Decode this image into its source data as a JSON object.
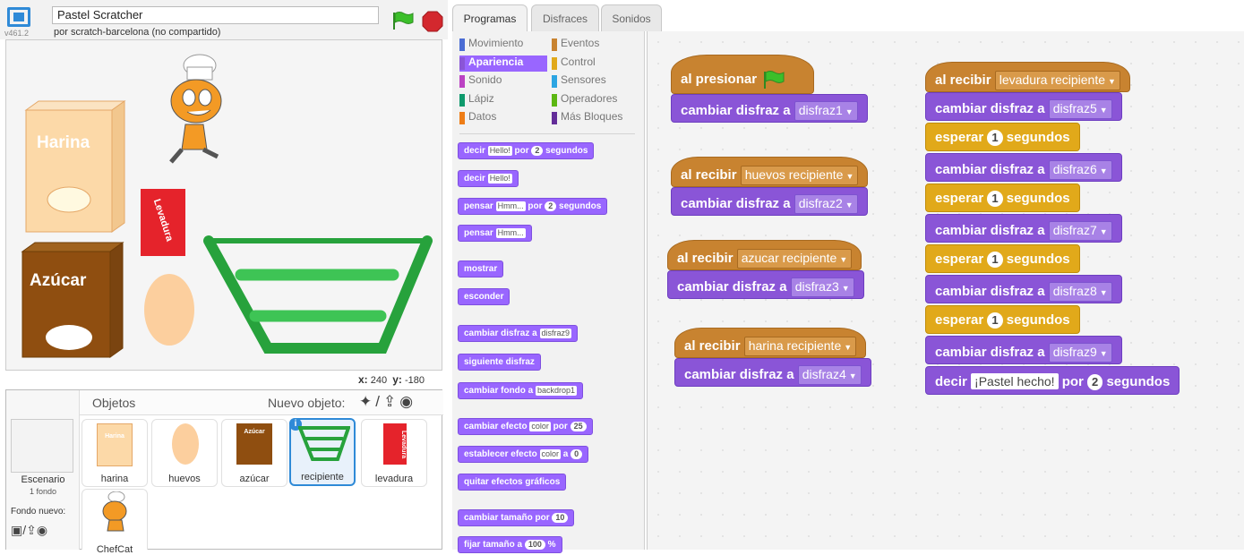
{
  "header": {
    "title": "Pastel Scratcher",
    "byline": "por scratch-barcelona (no compartido)",
    "version": "v461.2"
  },
  "stage": {
    "x_label": "x:",
    "x": "240",
    "y_label": "y:",
    "y": "-180",
    "items": {
      "harina": "Harina",
      "azucar": "Azúcar",
      "levadura": "Levadura"
    }
  },
  "sprites": {
    "title": "Objetos",
    "new_sprite": "Nuevo objeto:",
    "stage_label": "Escenario",
    "stage_sub": "1 fondo",
    "new_backdrop": "Fondo nuevo:",
    "tiles": [
      "harina",
      "huevos",
      "azúcar",
      "recipiente",
      "levadura",
      "ChefCat"
    ],
    "tile_texts": {
      "harina": "Harina",
      "azucar": "Azúcar",
      "levadura": "Levadura"
    }
  },
  "tabs": [
    "Programas",
    "Disfraces",
    "Sonidos"
  ],
  "categories": [
    {
      "label": "Movimiento",
      "color": "#4a6cd4"
    },
    {
      "label": "Eventos",
      "color": "#c88330"
    },
    {
      "label": "Apariencia",
      "color": "#8a55d7"
    },
    {
      "label": "Control",
      "color": "#e1a91a"
    },
    {
      "label": "Sonido",
      "color": "#bb42c3"
    },
    {
      "label": "Sensores",
      "color": "#2ca5e2"
    },
    {
      "label": "Lápiz",
      "color": "#0e9a6c"
    },
    {
      "label": "Operadores",
      "color": "#5cb712"
    },
    {
      "label": "Datos",
      "color": "#ee7d16"
    },
    {
      "label": "Más Bloques",
      "color": "#632d99"
    }
  ],
  "palette": {
    "say_secs": {
      "a": "decir",
      "in": "Hello!",
      "b": "por",
      "n": "2",
      "c": "segundos"
    },
    "say": {
      "a": "decir",
      "in": "Hello!"
    },
    "think_secs": {
      "a": "pensar",
      "in": "Hmm...",
      "b": "por",
      "n": "2",
      "c": "segundos"
    },
    "think": {
      "a": "pensar",
      "in": "Hmm..."
    },
    "show": "mostrar",
    "hide": "esconder",
    "switch_costume": {
      "a": "cambiar disfraz a",
      "dd": "disfraz9"
    },
    "next_costume": "siguiente disfraz",
    "switch_backdrop": {
      "a": "cambiar fondo a",
      "dd": "backdrop1"
    },
    "change_effect": {
      "a": "cambiar efecto",
      "dd": "color",
      "b": "por",
      "n": "25"
    },
    "set_effect": {
      "a": "establecer efecto",
      "dd": "color",
      "b": "a",
      "n": "0"
    },
    "clear_effects": "quitar efectos gráficos",
    "change_size": {
      "a": "cambiar tamaño por",
      "n": "10"
    },
    "set_size": {
      "a": "fijar tamaño a",
      "n": "100",
      "b": "%"
    }
  },
  "scripts": {
    "flag_hat": "al presionar",
    "recv": "al recibir",
    "switch": "cambiar disfraz a",
    "wait": "esperar",
    "secs": "segundos",
    "say": "decir",
    "por": "por",
    "s1": {
      "msg": "",
      "costume": "disfraz1"
    },
    "s2": {
      "msg": "huevos recipiente",
      "costume": "disfraz2"
    },
    "s3": {
      "msg": "azucar recipiente",
      "costume": "disfraz3"
    },
    "s4": {
      "msg": "harina recipiente",
      "costume": "disfraz4"
    },
    "s5": {
      "msg": "levadura recipiente",
      "c5": "disfraz5",
      "c6": "disfraz6",
      "c7": "disfraz7",
      "c8": "disfraz8",
      "c9": "disfraz9",
      "wait": "1",
      "say_text": "¡Pastel hecho!",
      "say_secs": "2"
    }
  },
  "colors": {
    "events": "#c88330",
    "looks": "#8a55d7",
    "control": "#e1a91a"
  }
}
